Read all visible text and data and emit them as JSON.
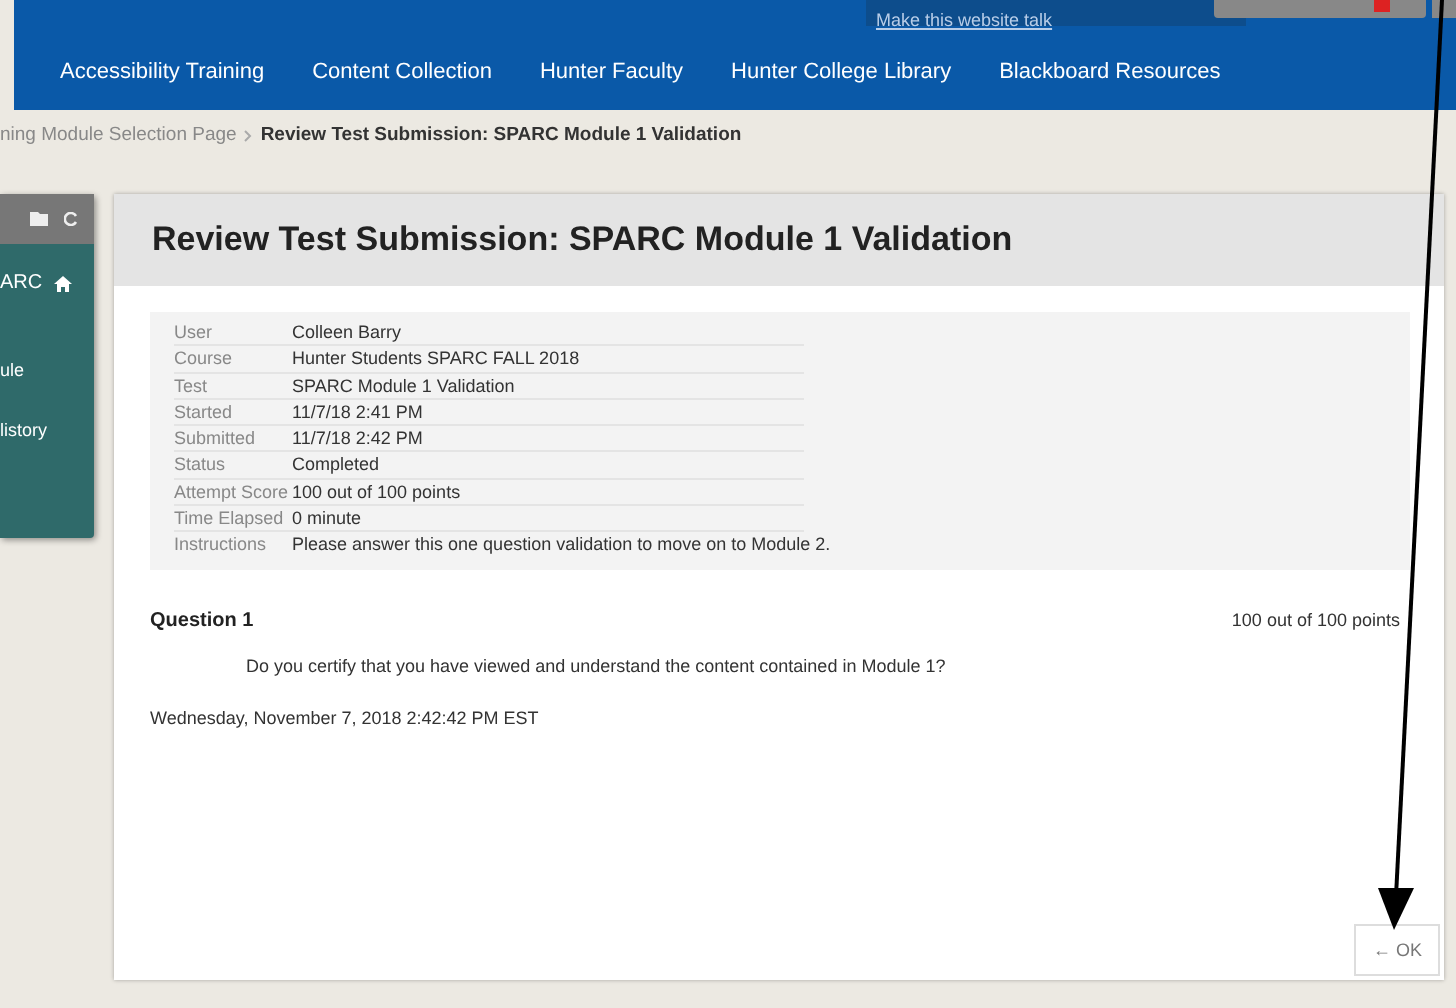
{
  "header": {
    "talk_link": "Make this website talk",
    "nav": [
      "Accessibility Training",
      "Content Collection",
      "Hunter Faculty",
      "Hunter College Library",
      "Blackboard Resources"
    ]
  },
  "breadcrumb": [
    "ning Module Selection Page",
    "Review Test Submission: SPARC Module 1 Validation"
  ],
  "sidebar": {
    "title": "ARC",
    "items": [
      "ule",
      "listory"
    ]
  },
  "page": {
    "title": "Review Test Submission: SPARC Module 1 Validation",
    "details": [
      {
        "label": "User",
        "value": "Colleen Barry"
      },
      {
        "label": "Course",
        "value": "Hunter Students SPARC FALL 2018"
      },
      {
        "label": "Test",
        "value": "SPARC Module 1 Validation"
      },
      {
        "label": "Started",
        "value": "11/7/18 2:41 PM"
      },
      {
        "label": "Submitted",
        "value": "11/7/18 2:42 PM"
      },
      {
        "label": "Status",
        "value": "Completed"
      },
      {
        "label": "Attempt Score",
        "value": "100 out of 100 points"
      },
      {
        "label": "Time Elapsed",
        "value": "0 minute"
      },
      {
        "label": "Instructions",
        "value": "Please answer this one question validation to move on to Module 2."
      }
    ],
    "question": {
      "title": "Question 1",
      "score": "100 out of 100 points",
      "text": "Do you certify that you have viewed and understand the content contained in Module 1?"
    },
    "timestamp": "Wednesday, November 7, 2018 2:42:42 PM EST",
    "ok_button": "← OK"
  }
}
